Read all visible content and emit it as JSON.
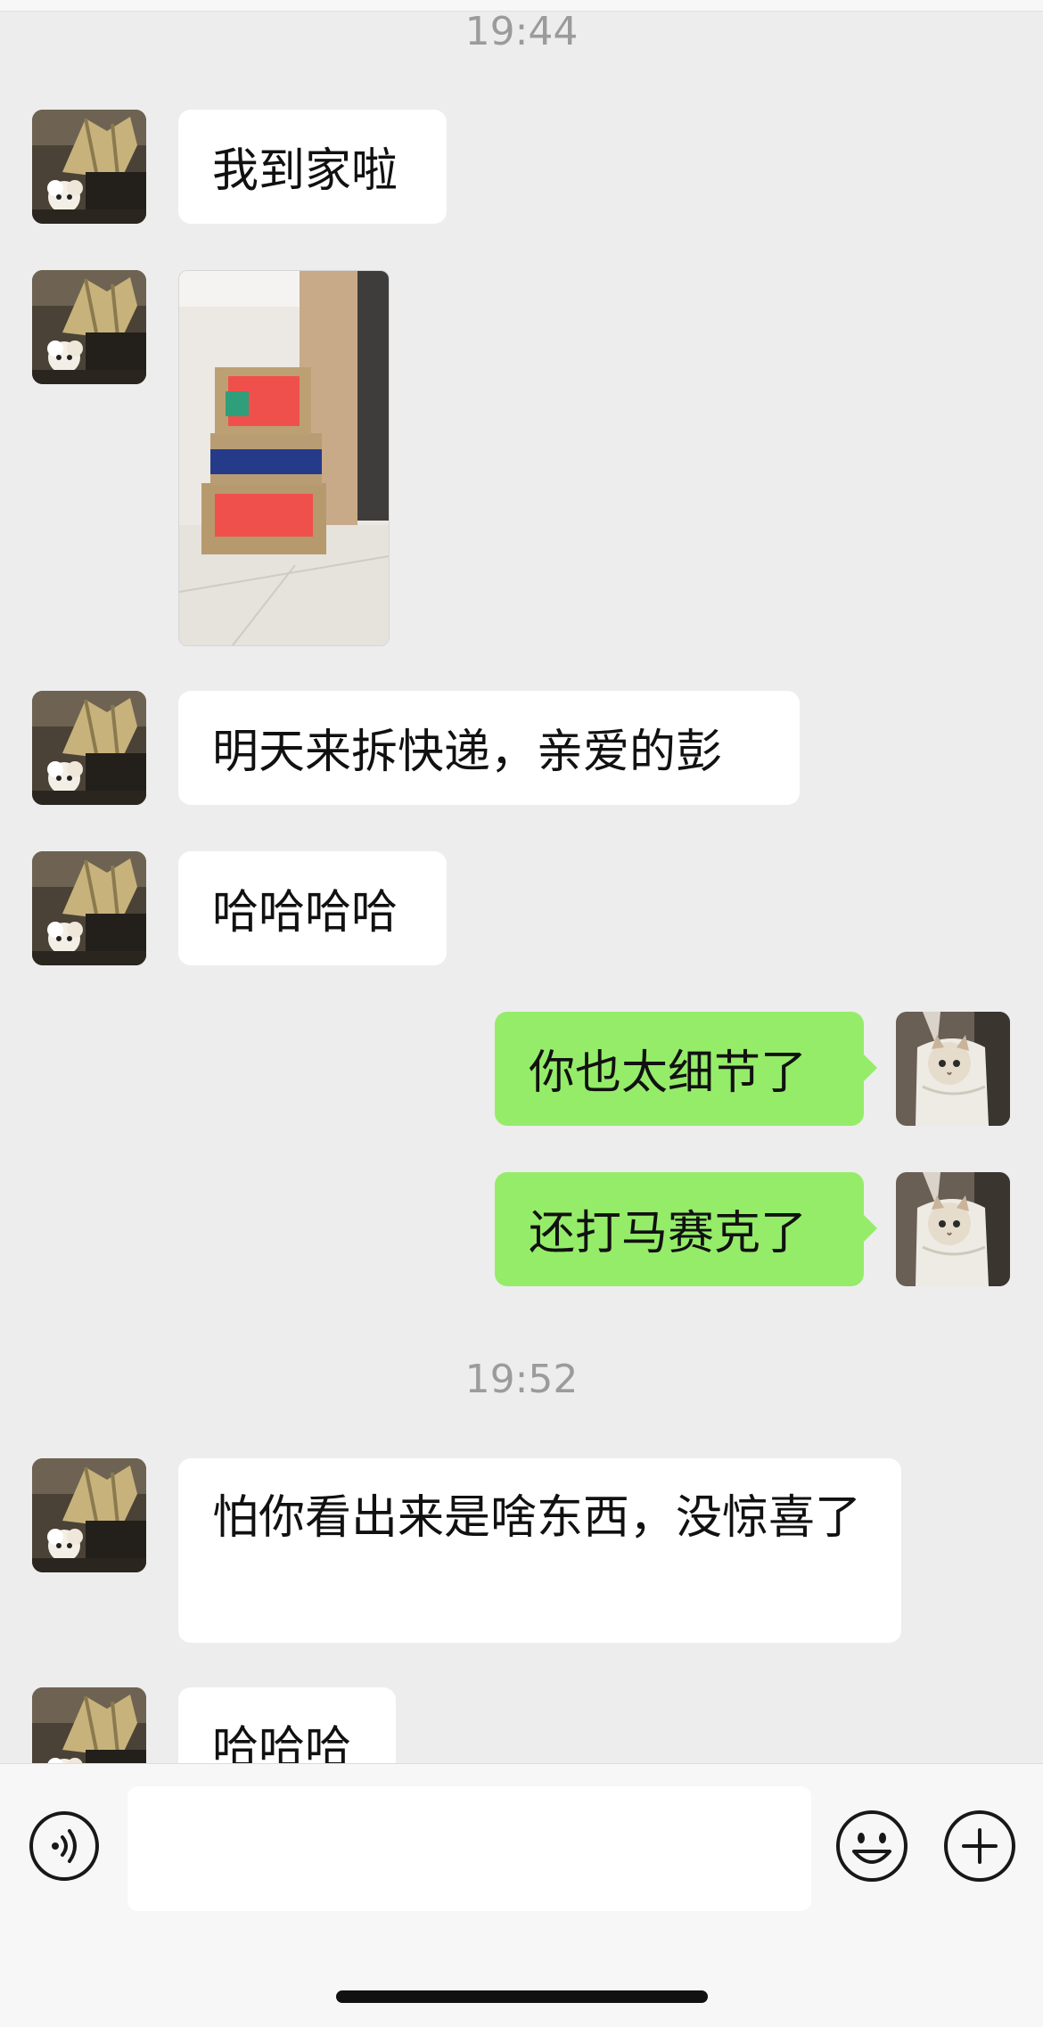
{
  "timestamps": [
    "19:44",
    "19:52"
  ],
  "messages": {
    "m1": "我到家啦",
    "m3": "明天来拆快递，亲爱的彭",
    "m4": "哈哈哈哈",
    "m5": "你也太细节了",
    "m6": "还打马赛克了",
    "m7": "怕你看出来是啥东西，没惊喜了",
    "m8": "哈哈哈"
  },
  "input": {
    "placeholder": ""
  },
  "icons": {
    "voice": "voice-icon",
    "emoji": "emoji-icon",
    "plus": "plus-icon"
  },
  "colors": {
    "background": "#ededed",
    "bubble_self": "#95ec69",
    "bubble_other": "#ffffff",
    "timestamp_text": "#9b9b9b"
  }
}
